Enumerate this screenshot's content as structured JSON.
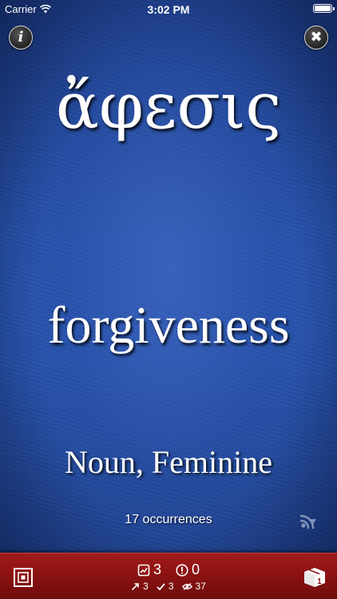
{
  "status_bar": {
    "carrier": "Carrier",
    "time": "3:02 PM",
    "wifi_icon": "wifi-icon",
    "battery_icon": "battery-icon"
  },
  "header": {
    "info_button": {
      "label": "i",
      "icon": "info-icon"
    },
    "close_button": {
      "label": "✖",
      "icon": "close-icon"
    }
  },
  "card": {
    "greek_word": "ἄφεσις",
    "english_word": "forgiveness",
    "part_of_speech": "Noun, Feminine",
    "occurrences": "17 occurrences",
    "audio_icon": "audio-icon"
  },
  "toolbar": {
    "deck_icon": "cards-deck-icon",
    "box_icon": "gift-box-icon",
    "box_badge": "1",
    "stats_top": [
      {
        "icon": "chart-icon",
        "value": "3"
      },
      {
        "icon": "alert-icon",
        "value": "0"
      }
    ],
    "stats_bottom": [
      {
        "icon": "arrow-up-icon",
        "value": "3"
      },
      {
        "icon": "check-icon",
        "value": "3"
      },
      {
        "icon": "eye-icon",
        "value": "37"
      }
    ]
  },
  "colors": {
    "background_blue": "#2552ad",
    "toolbar_red": "#8c1212",
    "text_white": "#ffffff"
  }
}
